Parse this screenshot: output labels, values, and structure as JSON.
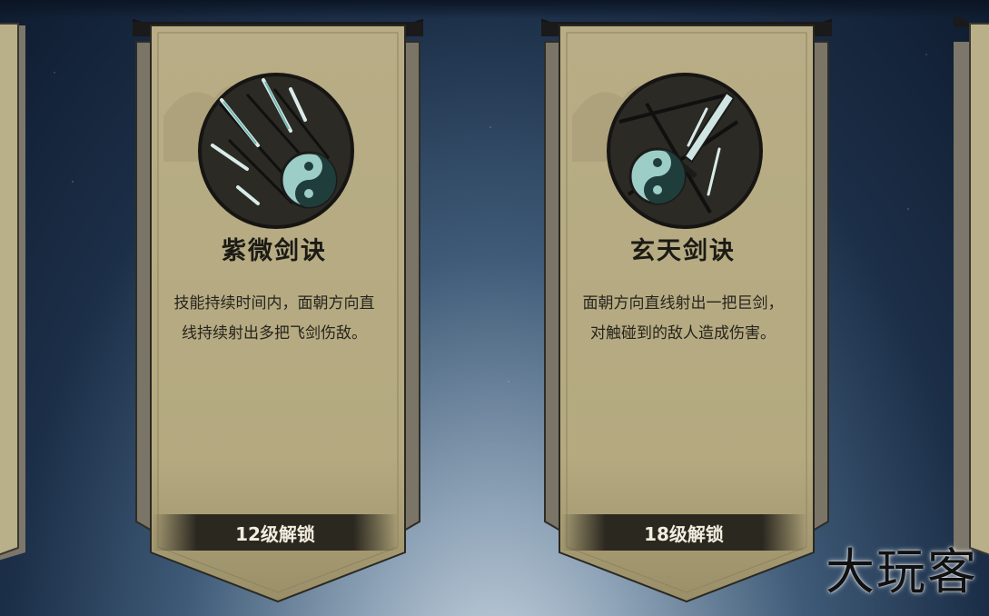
{
  "skills": [
    {
      "name": "紫微剑诀",
      "description": "技能持续时间内，面朝方向直线持续射出多把飞剑伤敌。",
      "unlock_label": "12级解锁",
      "icon": "flying-swords-icon"
    },
    {
      "name": "玄天剑诀",
      "description": "面朝方向直线射出一把巨剑，对触碰到的敌人造成伤害。",
      "unlock_label": "18级解锁",
      "icon": "giant-sword-icon"
    }
  ],
  "watermark": "大玩客",
  "colors": {
    "parchment": "#b8ae86",
    "banner_frame": "#7a7566",
    "ink": "#1b1a15",
    "unlock_bar": "#2b2820",
    "sky_top": "#0f1c30",
    "sky_bottom": "#cdd9e3"
  }
}
